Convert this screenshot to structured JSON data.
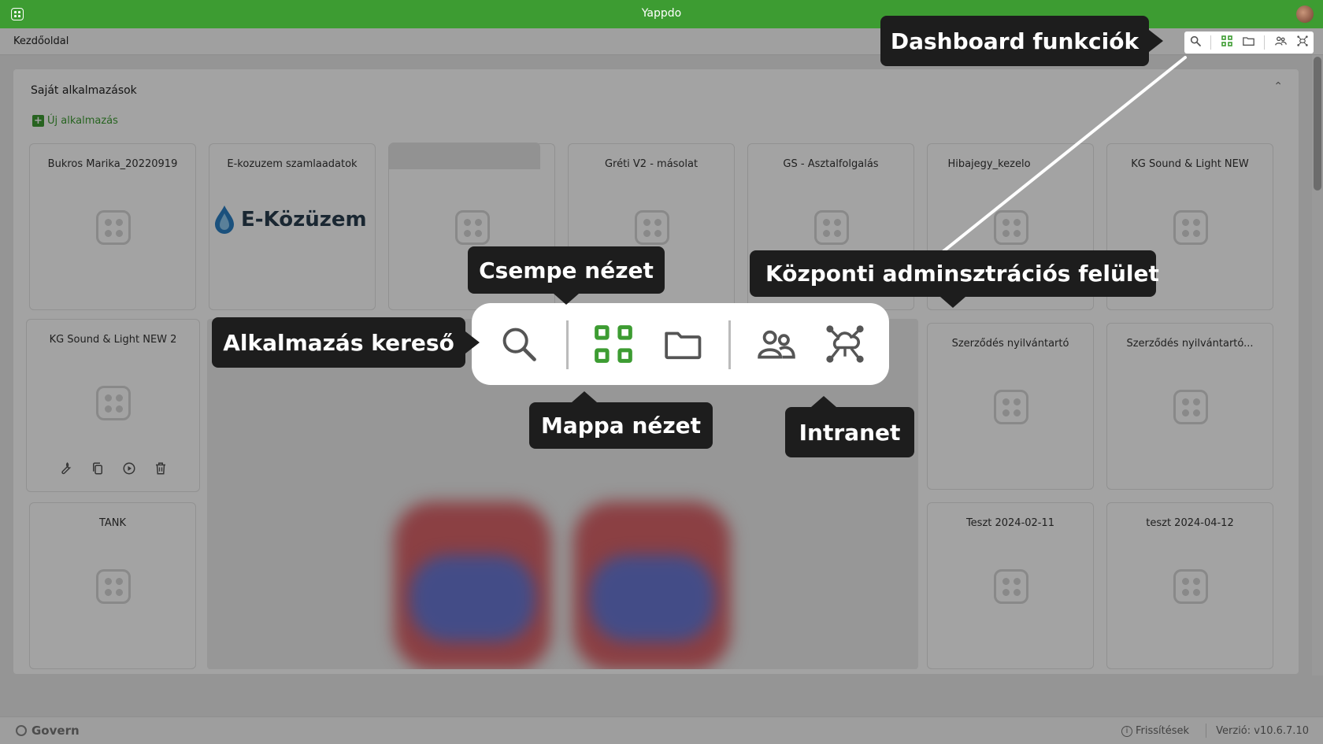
{
  "window": {
    "title": "Yappdo"
  },
  "topbar": {
    "breadcrumb": "Kezdőoldal"
  },
  "section": {
    "heading": "Saját alkalmazások",
    "new_app_label": "Új alkalmazás"
  },
  "apps": [
    {
      "name": "Bukros Marika_20220919"
    },
    {
      "name": "E-kozuzem szamlaadatok",
      "logo_text": "E-Közüzem"
    },
    {
      "name": ""
    },
    {
      "name": "Gréti V2 - másolat"
    },
    {
      "name": "GS - Asztalfolgalás"
    },
    {
      "name": "Hibajegy_kezelo"
    },
    {
      "name": "KG Sound & Light NEW"
    },
    {
      "name": "KG Sound & Light NEW 2"
    },
    {
      "name": "Szerződés nyilvántartó"
    },
    {
      "name": "Szerződés nyilvántartó..."
    },
    {
      "name": "TANK"
    },
    {
      "name": "Teszt 2024-02-11"
    },
    {
      "name": "teszt 2024-04-12"
    }
  ],
  "callouts": {
    "dashboard": "Dashboard funkciók",
    "tile_view": "Csempe nézet",
    "central_admin": "Központi adminsztrációs felület",
    "app_search": "Alkalmazás kereső",
    "folder_view": "Mappa nézet",
    "intranet": "Intranet"
  },
  "footer": {
    "brand": "Govern",
    "updates": "Frissítések",
    "version": "Verzió: v10.6.7.10"
  },
  "colors": {
    "brand_green": "#3d9c32",
    "callout_bg": "#1d1d1d"
  },
  "icons": [
    "search-icon",
    "grid-icon",
    "folder-icon",
    "users-icon",
    "network-icon",
    "wrench-icon",
    "copy-icon",
    "play-icon",
    "trash-icon"
  ]
}
